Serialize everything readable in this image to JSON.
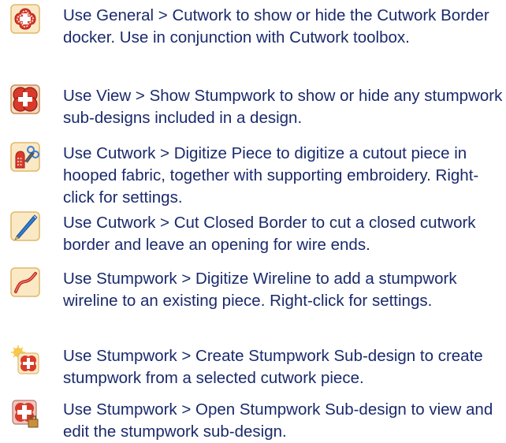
{
  "items": [
    {
      "icon": "cutwork-border-icon",
      "text": "Use General > Cutwork to show or hide the Cutwork Border docker. Use in conjunction with Cutwork toolbox."
    },
    {
      "icon": "show-stumpwork-icon",
      "text": "Use View > Show Stumpwork to show or hide any stumpwork sub-designs included in a design."
    },
    {
      "icon": "digitize-piece-icon",
      "text": "Use Cutwork > Digitize Piece to digitize a cutout piece in hooped fabric, together with supporting embroidery. Right-click for settings."
    },
    {
      "icon": "cut-closed-border-icon",
      "text": "Use Cutwork > Cut Closed Border to cut a closed cutwork border and leave an opening for wire ends."
    },
    {
      "icon": "digitize-wireline-icon",
      "text": "Use Stumpwork > Digitize Wireline to add a stumpwork wireline to an existing piece. Right-click for settings."
    },
    {
      "icon": "create-stumpwork-subdesign-icon",
      "text": "Use Stumpwork > Create Stumpwork Sub-design to create stumpwork from a selected cutwork piece."
    },
    {
      "icon": "open-stumpwork-subdesign-icon",
      "text": "Use Stumpwork > Open Stumpwork Sub-design to view and edit the stumpwork sub-design."
    }
  ]
}
